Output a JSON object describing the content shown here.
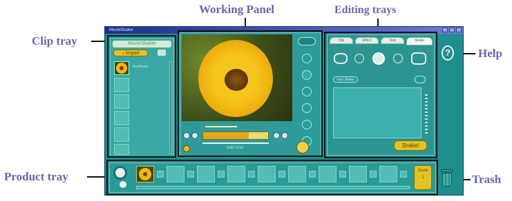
{
  "labels": {
    "working_panel": "Working Panel",
    "editing_trays": "Editing trays",
    "clip_tray": "Clip tray",
    "help": "Help",
    "product_tray": "Product tray",
    "trash": "Trash"
  },
  "app": {
    "title": "MovieShaker",
    "clip_tray": {
      "header": "MovieShaker",
      "import_button": "Import",
      "clip_label": "Sunflower"
    },
    "working_panel": {
      "time_readout": "0:00 / 0:14"
    },
    "editing_trays": {
      "tabs": [
        "Clip",
        "Effect",
        "Text",
        "Shake"
      ],
      "option_label": "Fast Shake",
      "shake_button": "Shake!"
    },
    "product_tray": {
      "done_button": "Done"
    }
  },
  "colors": {
    "window": "#1e8f8f",
    "panel": "#3aa7a3",
    "callout_text": "#6b63b0",
    "accent": "#e2c326"
  }
}
